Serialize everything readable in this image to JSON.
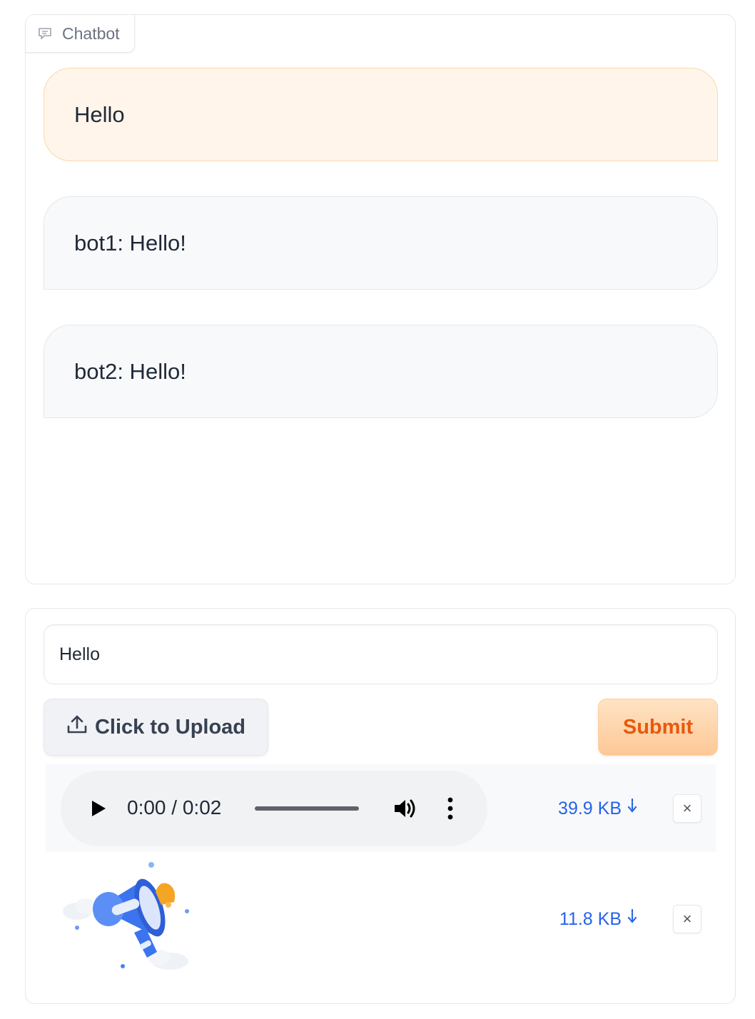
{
  "chatbot": {
    "label": "Chatbot",
    "messages": [
      {
        "role": "user",
        "text": "Hello"
      },
      {
        "role": "bot",
        "text": "bot1: Hello!"
      },
      {
        "role": "bot",
        "text": "bot2: Hello!"
      }
    ]
  },
  "input": {
    "value": "Hello",
    "upload_label": "Click to Upload",
    "submit_label": "Submit"
  },
  "files": [
    {
      "type": "audio",
      "current_time": "0:00",
      "duration": "0:02",
      "size": "39.9 KB",
      "remove": "×"
    },
    {
      "type": "image",
      "image_icon": "megaphone-icon",
      "size": "11.8 KB",
      "remove": "×"
    }
  ],
  "colors": {
    "accent": "#ea580c",
    "link": "#2563eb",
    "user_bubble": "#fff5ea",
    "bot_bubble": "#f8f9fb"
  }
}
